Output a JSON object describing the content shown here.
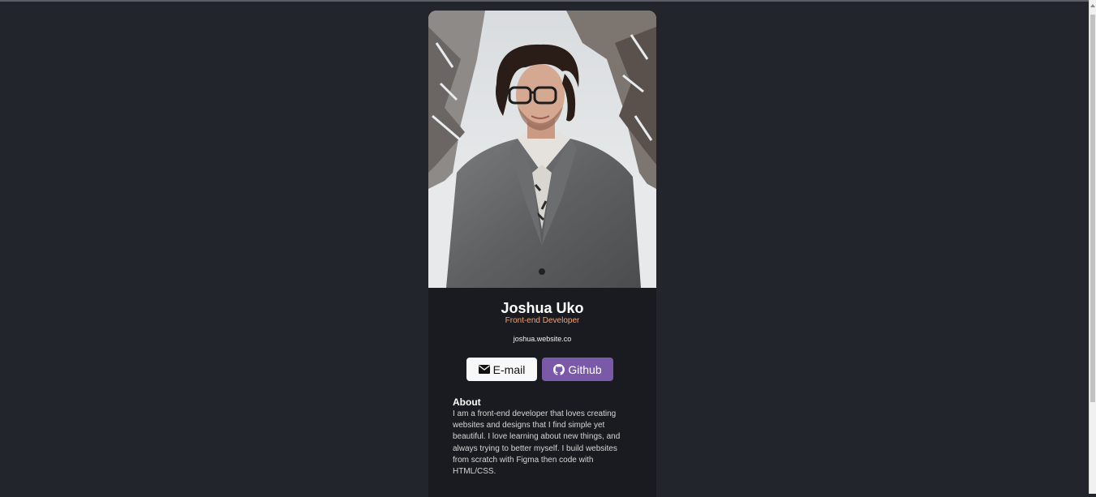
{
  "profile": {
    "name": "Joshua Uko",
    "role": "Front-end Developer",
    "website": "joshua.website.co"
  },
  "buttons": {
    "email_label": "E-mail",
    "email_icon": "envelope-icon",
    "github_label": "Github",
    "github_icon": "github-icon"
  },
  "about": {
    "heading": "About",
    "text": "I am a front-end developer that loves creating websites and designs that I find simple yet beautiful. I love learning about new things, and always trying to better myself. I build websites from scratch with Figma then code with HTML/CSS."
  },
  "colors": {
    "page_background": "#23252c",
    "card_background": "#1a1b20",
    "role_accent": "#f4a273",
    "github_button": "#7a5aa8",
    "email_button": "#f8f8f8"
  }
}
